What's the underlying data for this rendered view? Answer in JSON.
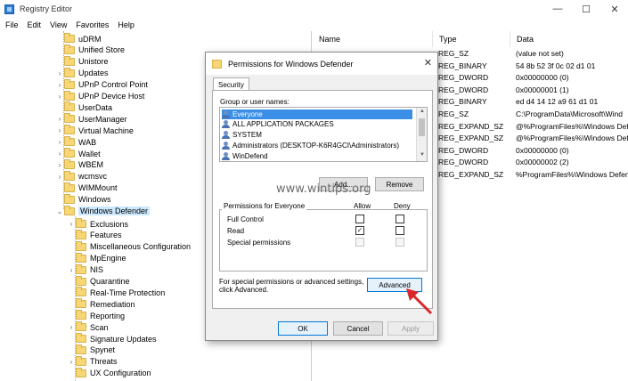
{
  "window": {
    "title": "Registry Editor",
    "minimize": "—",
    "maximize": "☐",
    "close": "✕"
  },
  "menu": [
    "File",
    "Edit",
    "View",
    "Favorites",
    "Help"
  ],
  "tree": {
    "items": [
      {
        "label": "uDRM",
        "expander": ""
      },
      {
        "label": "Unified Store",
        "expander": ""
      },
      {
        "label": "Unistore",
        "expander": ""
      },
      {
        "label": "Updates",
        "expander": "›"
      },
      {
        "label": "UPnP Control Point",
        "expander": "›"
      },
      {
        "label": "UPnP Device Host",
        "expander": "›"
      },
      {
        "label": "UserData",
        "expander": ""
      },
      {
        "label": "UserManager",
        "expander": "›"
      },
      {
        "label": "Virtual Machine",
        "expander": "›"
      },
      {
        "label": "WAB",
        "expander": "›"
      },
      {
        "label": "Wallet",
        "expander": "›"
      },
      {
        "label": "WBEM",
        "expander": "›"
      },
      {
        "label": "wcmsvc",
        "expander": "›"
      },
      {
        "label": "WIMMount",
        "expander": ""
      },
      {
        "label": "Windows",
        "expander": ""
      },
      {
        "label": "Windows Defender",
        "expander": "⌄"
      }
    ],
    "children": [
      {
        "label": "Exclusions",
        "expander": "›"
      },
      {
        "label": "Features",
        "expander": ""
      },
      {
        "label": "Miscellaneous Configuration",
        "expander": ""
      },
      {
        "label": "MpEngine",
        "expander": ""
      },
      {
        "label": "NIS",
        "expander": "›"
      },
      {
        "label": "Quarantine",
        "expander": ""
      },
      {
        "label": "Real-Time Protection",
        "expander": ""
      },
      {
        "label": "Remediation",
        "expander": ""
      },
      {
        "label": "Reporting",
        "expander": ""
      },
      {
        "label": "Scan",
        "expander": "›"
      },
      {
        "label": "Signature Updates",
        "expander": ""
      },
      {
        "label": "Spynet",
        "expander": ""
      },
      {
        "label": "Threats",
        "expander": "›"
      },
      {
        "label": "UX Configuration",
        "expander": ""
      }
    ]
  },
  "list": {
    "columns": [
      "Name",
      "Type",
      "Data"
    ],
    "rows": [
      {
        "type": "REG_SZ",
        "data": "(value not set)"
      },
      {
        "type": "REG_BINARY",
        "data": "54 8b 52 3f 0c 02 d1 01"
      },
      {
        "type": "REG_DWORD",
        "data": "0x00000000 (0)"
      },
      {
        "type": "REG_DWORD",
        "data": "0x00000001 (1)"
      },
      {
        "type": "REG_BINARY",
        "data": "ed d4 14 12 a9 61 d1 01"
      },
      {
        "type": "REG_SZ",
        "data": "C:\\ProgramData\\Microsoft\\Wind"
      },
      {
        "type": "REG_EXPAND_SZ",
        "data": "@%ProgramFiles%\\Windows Defe"
      },
      {
        "type": "REG_EXPAND_SZ",
        "data": "@%ProgramFiles%\\Windows Defe"
      },
      {
        "type": "REG_DWORD",
        "data": "0x00000000 (0)"
      },
      {
        "type": "REG_DWORD",
        "data": "0x00000002 (2)"
      },
      {
        "type": "REG_EXPAND_SZ",
        "data": "%ProgramFiles%\\Windows Defen"
      }
    ]
  },
  "dialog": {
    "title": "Permissions for Windows Defender",
    "close": "✕",
    "tab": "Security",
    "group_label": "Group or user names:",
    "users": [
      "Everyone",
      "ALL APPLICATION PACKAGES",
      "SYSTEM",
      "Administrators (DESKTOP-K6R4GCI\\Administrators)",
      "WinDefend"
    ],
    "add": "Add...",
    "remove": "Remove",
    "perms_label": "Permissions for Everyone",
    "allow": "Allow",
    "deny": "Deny",
    "perms": [
      {
        "label": "Full Control",
        "allow": false,
        "deny": false,
        "enabled": true
      },
      {
        "label": "Read",
        "allow": true,
        "deny": false,
        "enabled": true
      },
      {
        "label": "Special permissions",
        "allow": false,
        "deny": false,
        "enabled": false
      }
    ],
    "special_text_1": "For special permissions or advanced settings,",
    "special_text_2": "click Advanced.",
    "advanced": "Advanced",
    "ok": "OK",
    "cancel": "Cancel",
    "apply": "Apply"
  },
  "watermark": "www.wintips.org",
  "colors": {
    "selection": "#cce8ff",
    "user_selection": "#3a8ee6",
    "arrow": "#d9262b"
  }
}
